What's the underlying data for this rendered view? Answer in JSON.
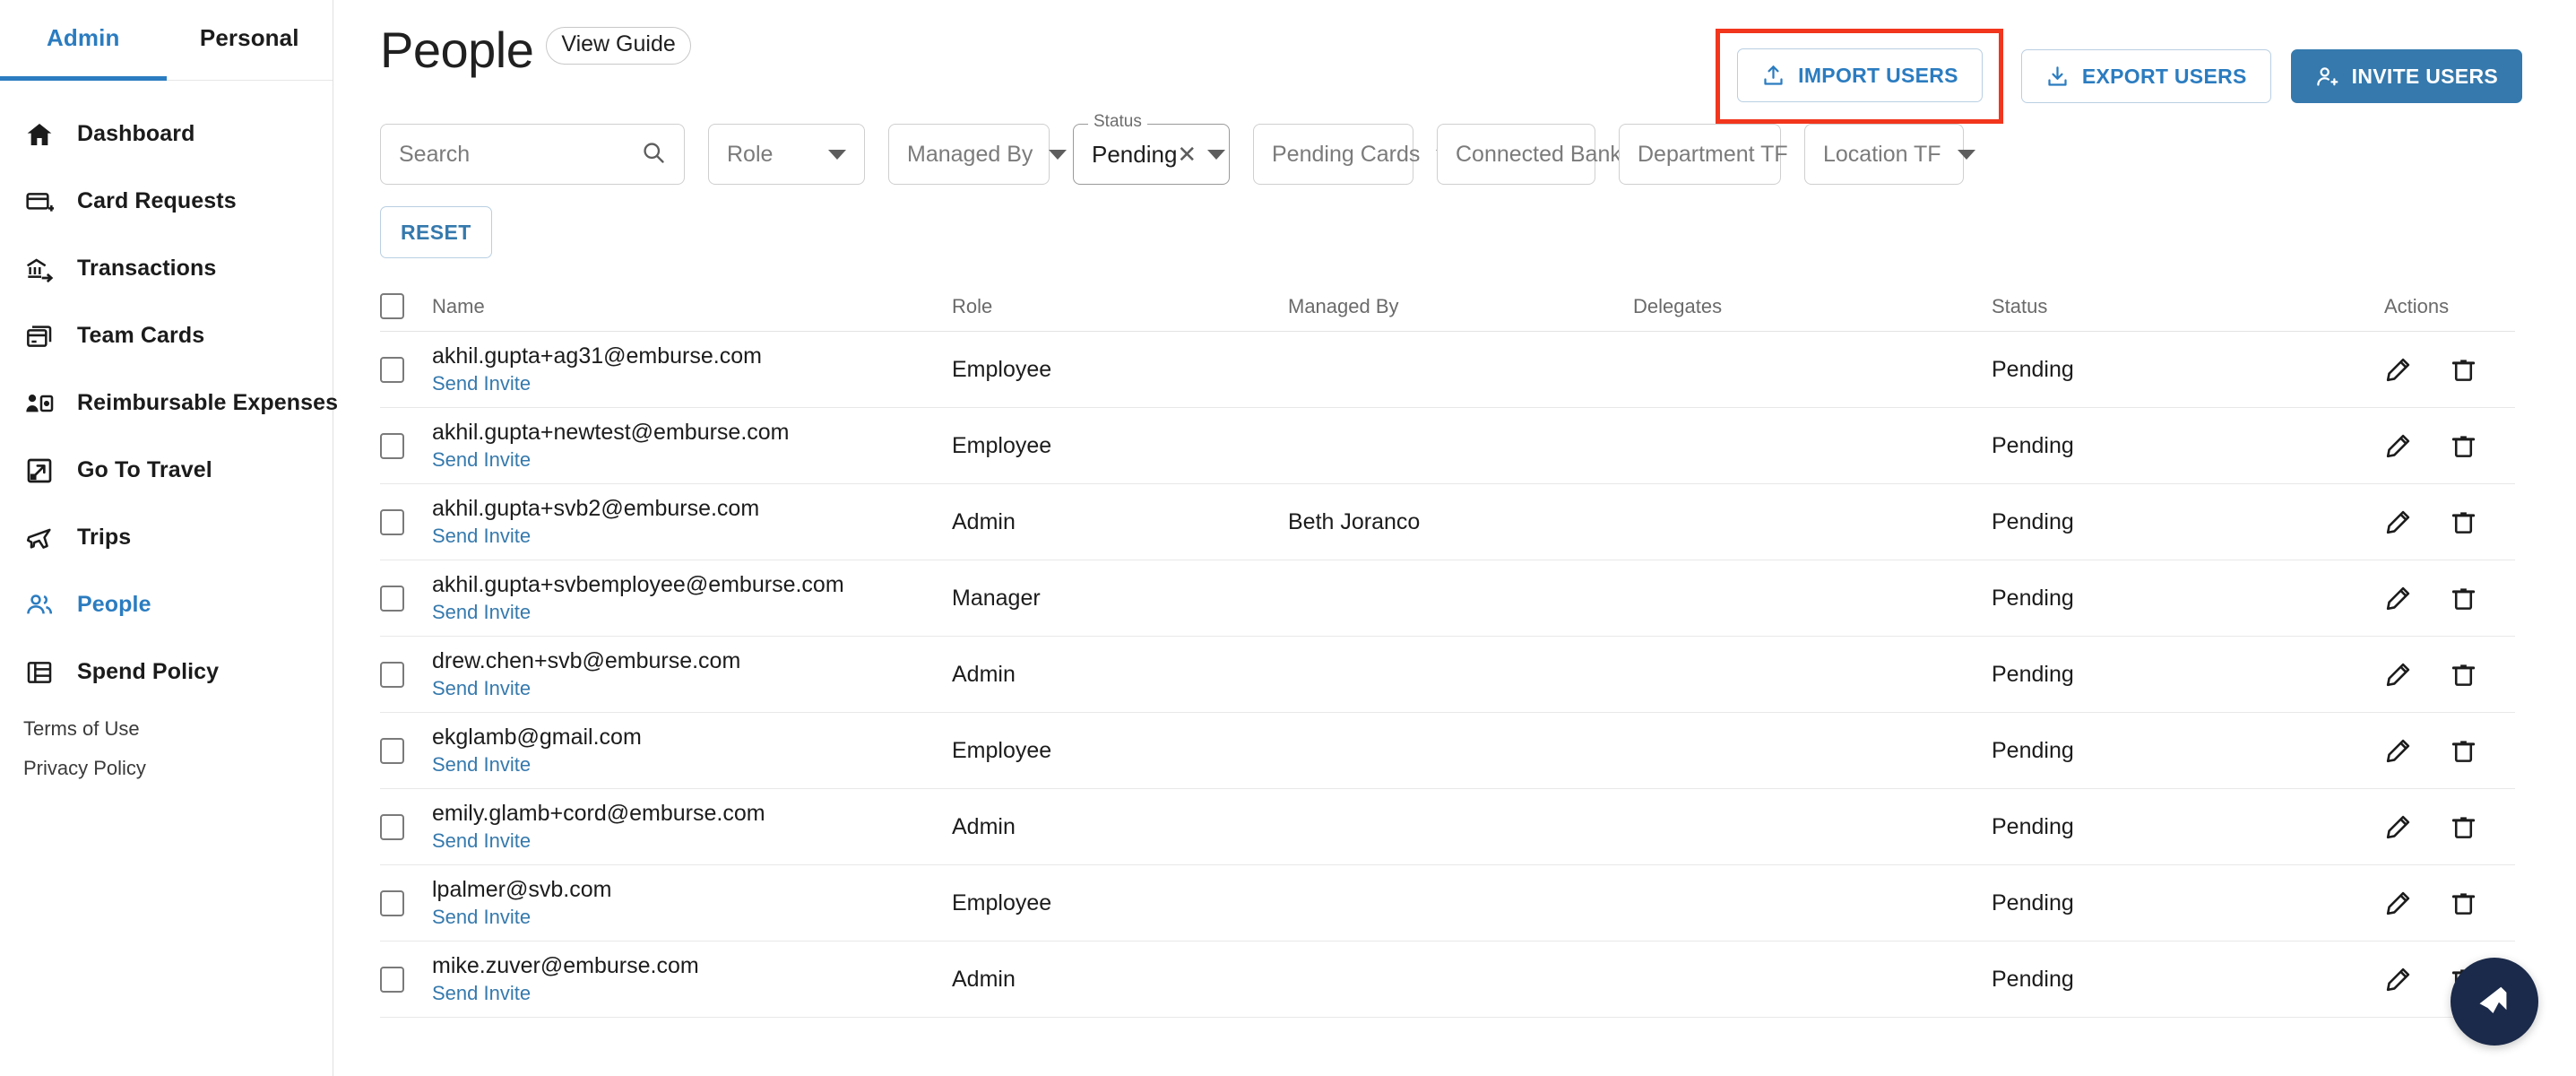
{
  "sidebar": {
    "mode_tabs": [
      {
        "label": "Admin",
        "active": true
      },
      {
        "label": "Personal",
        "active": false
      }
    ],
    "items": [
      {
        "label": "Dashboard",
        "icon": "home-icon",
        "active": false
      },
      {
        "label": "Card Requests",
        "icon": "card-plus-icon",
        "active": false
      },
      {
        "label": "Transactions",
        "icon": "bank-transfer-icon",
        "active": false
      },
      {
        "label": "Team Cards",
        "icon": "team-cards-icon",
        "active": false
      },
      {
        "label": "Reimbursable Expenses",
        "icon": "person-money-icon",
        "active": false
      },
      {
        "label": "Go To Travel",
        "icon": "external-link-icon",
        "active": false
      },
      {
        "label": "Trips",
        "icon": "airplane-icon",
        "active": false
      },
      {
        "label": "People",
        "icon": "people-icon",
        "active": true
      },
      {
        "label": "Spend Policy",
        "icon": "policy-list-icon",
        "active": false
      }
    ],
    "legal": [
      {
        "label": "Terms of Use"
      },
      {
        "label": "Privacy Policy"
      }
    ]
  },
  "header": {
    "title": "People",
    "view_guide_label": "View Guide",
    "actions": [
      {
        "label": "IMPORT USERS",
        "icon": "upload-icon",
        "style": "outline",
        "highlighted": true
      },
      {
        "label": "EXPORT USERS",
        "icon": "download-icon",
        "style": "outline",
        "highlighted": false
      },
      {
        "label": "INVITE USERS",
        "icon": "person-add-icon",
        "style": "primary",
        "highlighted": false
      }
    ],
    "highlight_color": "#f1361d",
    "accent_color": "#3579ad"
  },
  "filters": {
    "search": {
      "placeholder": "Search",
      "value": ""
    },
    "role": {
      "placeholder": "Role",
      "value": ""
    },
    "managed_by": {
      "placeholder": "Managed By",
      "value": ""
    },
    "status": {
      "label": "Status",
      "value": "Pending",
      "clear_glyph": "✕"
    },
    "pending_cards": {
      "placeholder": "Pending Cards",
      "value": ""
    },
    "connected_bank": {
      "placeholder": "Connected Bank",
      "value": ""
    },
    "department_tf": {
      "placeholder": "Department TF",
      "value": ""
    },
    "location_tf": {
      "placeholder": "Location TF",
      "value": ""
    },
    "reset_label": "RESET"
  },
  "table": {
    "columns": [
      "Name",
      "Role",
      "Managed By",
      "Delegates",
      "Status",
      "Actions"
    ],
    "send_invite_label": "Send Invite",
    "rows": [
      {
        "name": "akhil.gupta+ag31@emburse.com",
        "role": "Employee",
        "managed_by": "",
        "delegates": "",
        "status": "Pending"
      },
      {
        "name": "akhil.gupta+newtest@emburse.com",
        "role": "Employee",
        "managed_by": "",
        "delegates": "",
        "status": "Pending"
      },
      {
        "name": "akhil.gupta+svb2@emburse.com",
        "role": "Admin",
        "managed_by": "Beth Joranco",
        "delegates": "",
        "status": "Pending"
      },
      {
        "name": "akhil.gupta+svbemployee@emburse.com",
        "role": "Manager",
        "managed_by": "",
        "delegates": "",
        "status": "Pending"
      },
      {
        "name": "drew.chen+svb@emburse.com",
        "role": "Admin",
        "managed_by": "",
        "delegates": "",
        "status": "Pending"
      },
      {
        "name": "ekglamb@gmail.com",
        "role": "Employee",
        "managed_by": "",
        "delegates": "",
        "status": "Pending"
      },
      {
        "name": "emily.glamb+cord@emburse.com",
        "role": "Admin",
        "managed_by": "",
        "delegates": "",
        "status": "Pending"
      },
      {
        "name": "lpalmer@svb.com",
        "role": "Employee",
        "managed_by": "",
        "delegates": "",
        "status": "Pending"
      },
      {
        "name": "mike.zuver@emburse.com",
        "role": "Admin",
        "managed_by": "",
        "delegates": "",
        "status": "Pending"
      }
    ],
    "row_actions": [
      {
        "icon": "edit-pencil-icon",
        "name": "edit-user-button"
      },
      {
        "icon": "trash-icon",
        "name": "delete-user-button"
      }
    ]
  },
  "chat": {
    "icon": "chat-support-icon",
    "color": "#1b2a4a"
  }
}
